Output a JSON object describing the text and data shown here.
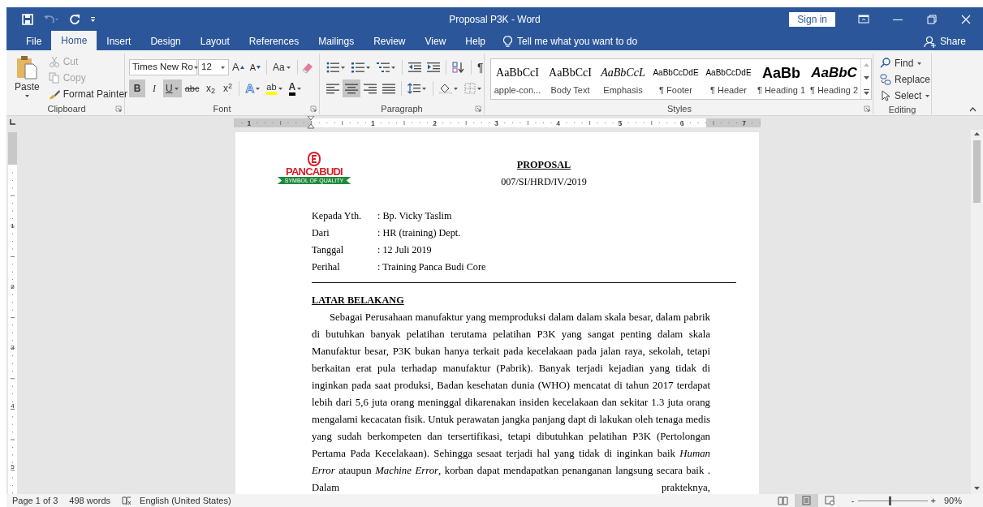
{
  "window": {
    "title": "Proposal P3K  -  Word",
    "sign_in": "Sign in"
  },
  "tabs": [
    {
      "label": "File",
      "selected": false
    },
    {
      "label": "Home",
      "selected": true
    },
    {
      "label": "Insert",
      "selected": false
    },
    {
      "label": "Design",
      "selected": false
    },
    {
      "label": "Layout",
      "selected": false
    },
    {
      "label": "References",
      "selected": false
    },
    {
      "label": "Mailings",
      "selected": false
    },
    {
      "label": "Review",
      "selected": false
    },
    {
      "label": "View",
      "selected": false
    },
    {
      "label": "Help",
      "selected": false
    }
  ],
  "tell_me": "Tell me what you want to do",
  "share": "Share",
  "clipboard": {
    "title": "Clipboard",
    "paste": "Paste",
    "commands": [
      {
        "label": "Cut",
        "disabled": true
      },
      {
        "label": "Copy",
        "disabled": true
      },
      {
        "label": "Format Painter",
        "disabled": false
      }
    ]
  },
  "font": {
    "title": "Font",
    "name": "Times New Ro",
    "size": "12",
    "grow": "A",
    "shrink": "A",
    "change_case": "Aa",
    "text_effects": "A",
    "highlight": "ab",
    "font_color": "A",
    "buttons": [
      {
        "kind": "bold",
        "label": "B",
        "on": true
      },
      {
        "kind": "italic",
        "label": "I",
        "on": false
      },
      {
        "kind": "underline",
        "label": "U",
        "on": true
      },
      {
        "kind": "strike",
        "label": "abc",
        "on": false
      },
      {
        "kind": "subscript",
        "label": "x$_{2}$",
        "on": false
      },
      {
        "kind": "superscript",
        "label": "x$^{2}$",
        "on": false
      }
    ]
  },
  "paragraph": {
    "title": "Paragraph",
    "pilcrow": "¶",
    "alignment": [
      {
        "kind": "left",
        "selected": false
      },
      {
        "kind": "center",
        "selected": true
      },
      {
        "kind": "right",
        "selected": false
      },
      {
        "kind": "justify",
        "selected": false
      }
    ]
  },
  "styles": {
    "title": "Styles",
    "items": [
      {
        "preview": "AaBbCcI",
        "name": "apple-con...",
        "kind": "serif"
      },
      {
        "preview": "AaBbCcI",
        "name": "Body Text",
        "kind": "serif"
      },
      {
        "preview": "AaBbCcL",
        "name": "Emphasis",
        "kind": "italic"
      },
      {
        "preview": "AaBbCcDdE",
        "name": "¶ Footer",
        "kind": "small"
      },
      {
        "preview": "AaBbCcDdE",
        "name": "¶ Header",
        "kind": "small"
      },
      {
        "preview": "AaBb",
        "name": "¶ Heading 1",
        "kind": "heading"
      },
      {
        "preview": "AaBbC",
        "name": "¶ Heading 2",
        "kind": "heading-italic"
      }
    ]
  },
  "editing": {
    "title": "Editing",
    "commands": [
      "Find",
      "Replace",
      "Select"
    ]
  },
  "ruler": {
    "labels": [
      "1",
      "1",
      "2",
      "3",
      "4",
      "5",
      "6",
      "7"
    ]
  },
  "vertical_ruler": {
    "labels": [
      "1",
      "2",
      "3",
      "4",
      "5"
    ]
  },
  "document": {
    "logo": {
      "name": "PANCABUDI",
      "tagline": "SYMBOL OF QUALITY"
    },
    "title": "PROPOSAL",
    "number": "007/SI/HRD/IV/2019",
    "fields": [
      {
        "label": "Kepada Yth.",
        "value": ": Bp. Vicky Taslim"
      },
      {
        "label": "Dari",
        "value": ": HR (training) Dept."
      },
      {
        "label": "Tanggal",
        "value": ": 12 Juli 2019"
      },
      {
        "label": "Perihal",
        "value": ": Training Panca Budi Core"
      }
    ],
    "heading": "LATAR BELAKANG",
    "body": "Sebagai Perusahaan manufaktur yang memproduksi dalam dalam skala besar, dalam pabrik di butuhkan banyak pelatihan terutama pelatihan P3K yang sangat penting dalam skala Manufaktur besar, P3K bukan hanya terkait pada kecelakaan pada jalan raya, sekolah, tetapi berkaitan erat pula terhadap manufaktur (Pabrik). Banyak terjadi kejadian yang tidak di inginkan pada saat produksi, Badan kesehatan dunia (WHO) mencatat di tahun 2017 terdapat lebih dari 5,6 juta orang meninggal dikarenakan insiden kecelakaan dan sekitar 1.3 juta orang mengalami kecacatan fisik. Untuk perawatan jangka panjang dapt di lakukan oleh tenaga medis yang sudah berkompeten dan tersertifikasi, tetapi dibutuhkan pelatihan P3K (Pertolongan Pertama Pada Kecelakaan). Sehingga sesaat terjadi hal yang tidak di inginkan baik *Human Error* ataupun *Machine Error*, korban dapat mendapatkan penanganan langsung secara baik . Dalam prakteknya,"
  },
  "status_bar": {
    "page": "Page 1 of 3",
    "words": "498 words",
    "language": "English (United States)",
    "views": [
      {
        "kind": "read",
        "selected": false
      },
      {
        "kind": "print",
        "selected": true
      },
      {
        "kind": "web",
        "selected": false
      }
    ],
    "zoom_out": "-",
    "zoom_in": "+",
    "zoom": {
      "level": 0.45
    },
    "zoom_label": "90%"
  }
}
